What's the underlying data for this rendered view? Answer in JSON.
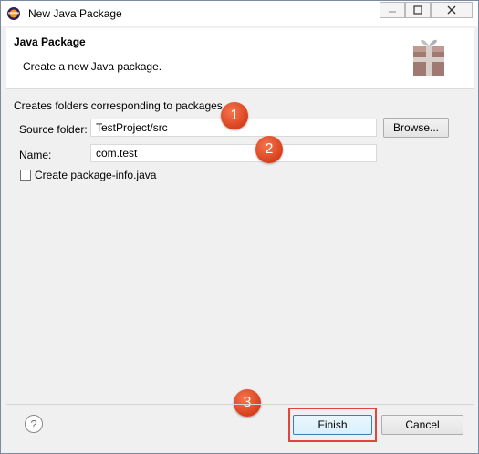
{
  "window": {
    "title": "New Java Package",
    "controls": {
      "minimize": "—",
      "maximize": "☐",
      "close": "✕"
    }
  },
  "header": {
    "title": "Java Package",
    "description": "Create a new Java package.",
    "icon": "package-gift-icon"
  },
  "form": {
    "info_text": "Creates folders corresponding to packages.",
    "source_folder_label": "Source folder:",
    "source_folder_value": "TestProject/src",
    "browse_label": "Browse...",
    "name_label": "Name:",
    "name_value": "com.test",
    "package_info_label": "Create package-info.java",
    "package_info_checked": false
  },
  "markers": [
    "1",
    "2",
    "3"
  ],
  "footer": {
    "help_label": "?",
    "finish_label": "Finish",
    "cancel_label": "Cancel"
  },
  "colors": {
    "marker": "#e0502a",
    "highlight_border": "#e0463c"
  }
}
